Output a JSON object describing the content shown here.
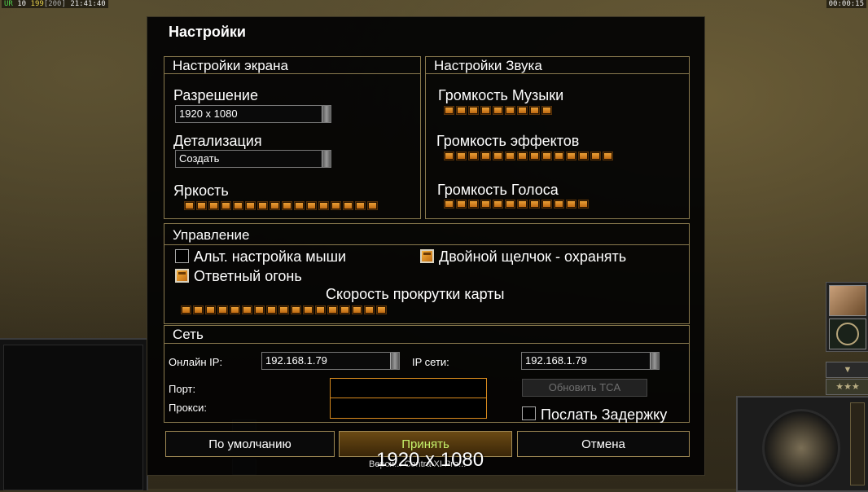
{
  "hud": {
    "top_left": {
      "prefix": "UR",
      "level": "10",
      "money": "199",
      "power": "[200]",
      "clock": "21:41:40"
    },
    "top_right_timer": "00:00:15",
    "stars_label": "★★★",
    "down_arrow": "▼"
  },
  "dialog": {
    "title": "Настройки",
    "screen": {
      "title": "Настройки экрана",
      "resolution_label": "Разрешение",
      "resolution_value": "1920 x 1080",
      "detail_label": "Детализация",
      "detail_value": "Создать",
      "brightness_label": "Яркость",
      "brightness_segments": 16,
      "brightness_level": 1.0
    },
    "sound": {
      "title": "Настройки Звука",
      "music_label": "Громкость Музыки",
      "music_segments": 9,
      "music_level": 1.0,
      "effects_label": "Громкость эффектов",
      "effects_segments": 14,
      "effects_level": 1.0,
      "voice_label": "Громкость Голоса",
      "voice_segments": 12,
      "voice_level": 1.0
    },
    "controls": {
      "title": "Управление",
      "alt_mouse_label": "Альт. настройка мыши",
      "alt_mouse_checked": false,
      "double_click_label": "Двойной щелчок - охранять",
      "double_click_checked": true,
      "return_fire_label": "Ответный огонь",
      "return_fire_checked": true,
      "scroll_speed_label": "Скорость прокрутки карты",
      "scroll_speed_segments": 17,
      "scroll_speed_level": 1.0
    },
    "network": {
      "title": "Сеть",
      "online_ip_label": "Онлайн IP:",
      "online_ip_value": "192.168.1.79",
      "lan_ip_label": "IP сети:",
      "lan_ip_value": "192.168.1.79",
      "port_label": "Порт:",
      "proxy_label": "Прокси:",
      "update_tca_label": "Обновить TCA",
      "send_delay_label": "Послать Задержку",
      "send_delay_checked": false
    },
    "buttons": {
      "default_label": "По умолчанию",
      "accept_label": "Принять",
      "cancel_label": "Отмена"
    }
  },
  "overlay": {
    "resolution_text": "1920 x 1080",
    "version_text": "Верси... Contra XI Pro..."
  }
}
